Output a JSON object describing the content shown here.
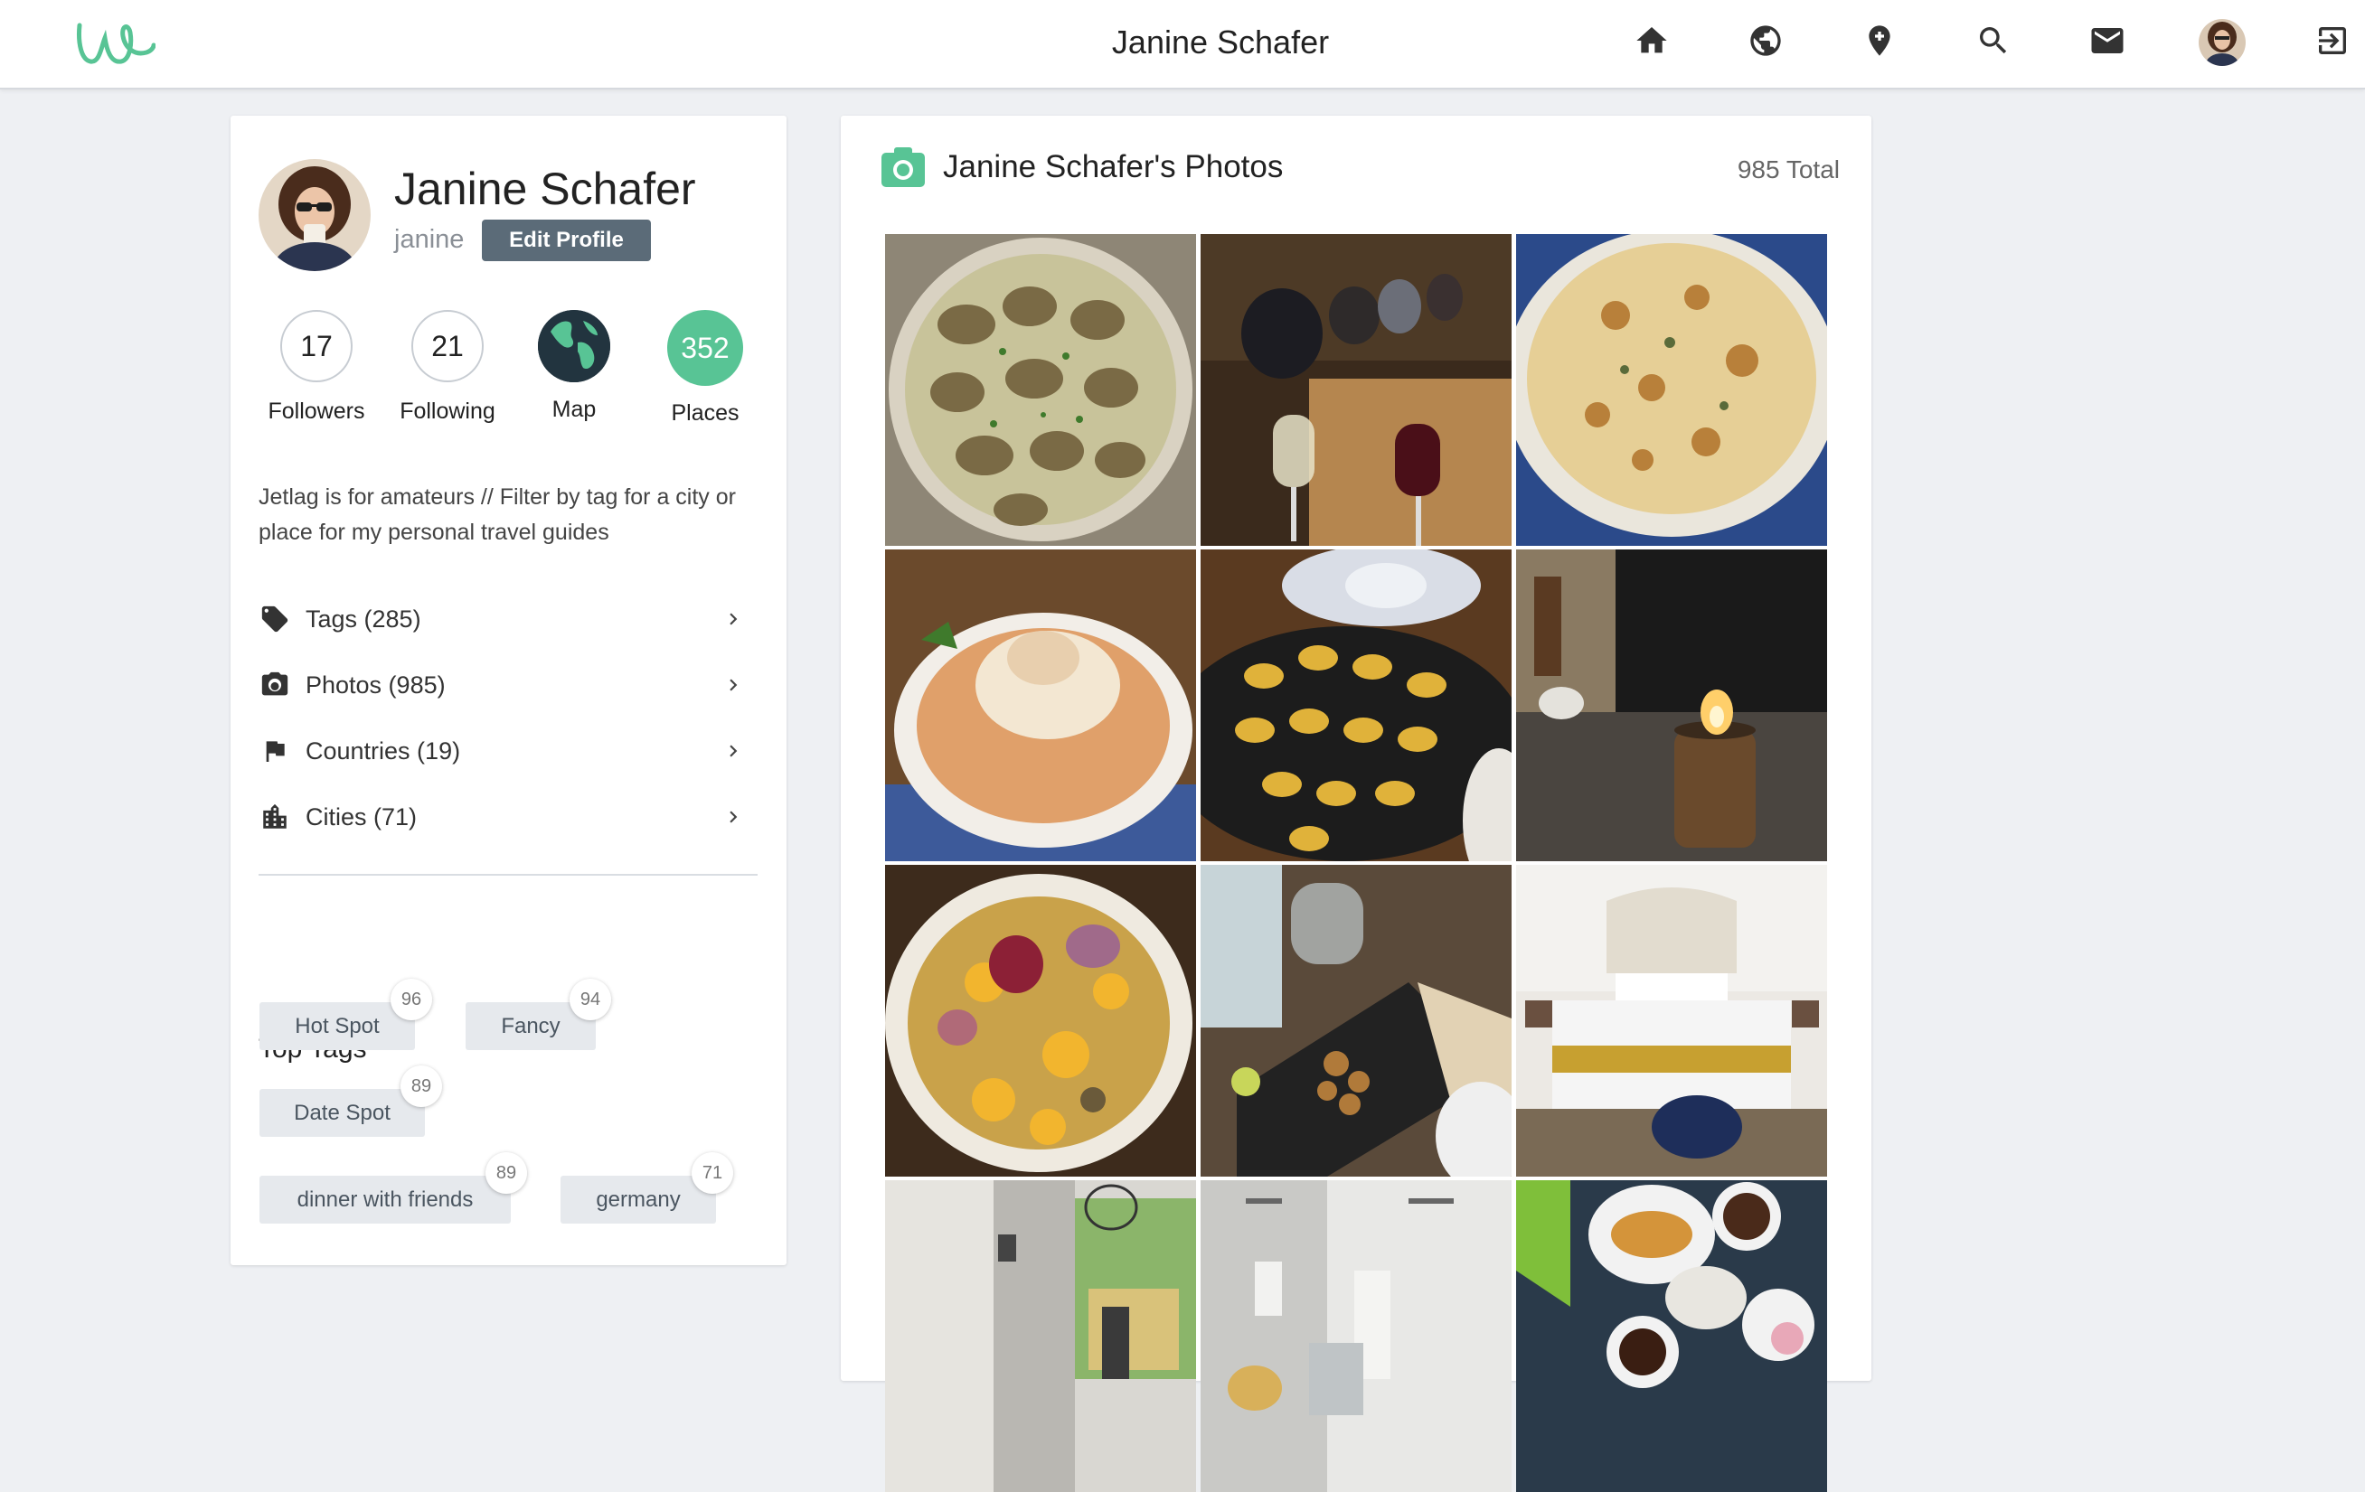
{
  "topbar": {
    "logo": "w-script-logo",
    "title": "Janine Schafer",
    "icons": [
      "home-icon",
      "globe-icon",
      "map-pin-icon",
      "search-icon",
      "mail-icon",
      "avatar",
      "logout-icon"
    ]
  },
  "profile": {
    "name": "Janine Schafer",
    "username": "janine",
    "edit_label": "Edit Profile",
    "stats": {
      "followers": {
        "value": "17",
        "label": "Followers"
      },
      "following": {
        "value": "21",
        "label": "Following"
      },
      "map": {
        "label": "Map"
      },
      "places": {
        "value": "352",
        "label": "Places"
      }
    },
    "bio": "Jetlag is for amateurs // Filter by tag for a city or place for my personal travel guides",
    "menu": [
      {
        "icon": "tag-icon",
        "label": "Tags (285)"
      },
      {
        "icon": "camera-icon",
        "label": "Photos (985)"
      },
      {
        "icon": "flag-icon",
        "label": "Countries (19)"
      },
      {
        "icon": "city-icon",
        "label": "Cities (71)"
      }
    ],
    "top_tags_title": "Top Tags",
    "tags": [
      {
        "label": "Hot Spot",
        "count": "96"
      },
      {
        "label": "Fancy",
        "count": "94"
      },
      {
        "label": "Date Spot",
        "count": "89"
      },
      {
        "label": "dinner with friends",
        "count": "89"
      },
      {
        "label": "germany",
        "count": "71"
      }
    ]
  },
  "photos": {
    "title": "Janine Schafer's Photos",
    "total": "985 Total"
  },
  "colors": {
    "accent_green": "#58c495",
    "edit_button": "#5b6b78",
    "globe_bg": "#22343f",
    "tag_bg": "#e6e9ed"
  }
}
